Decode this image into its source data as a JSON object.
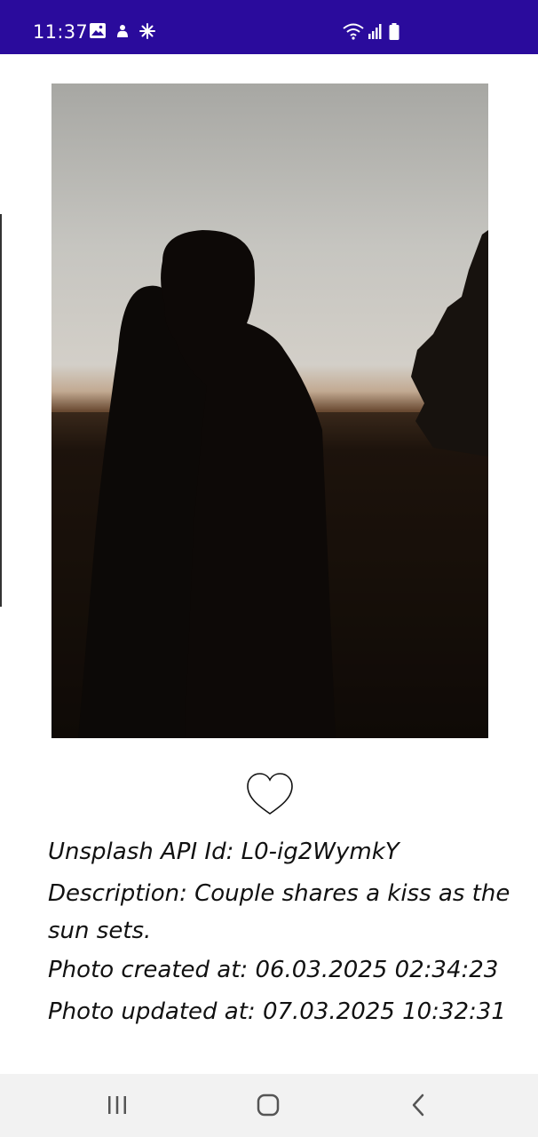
{
  "status_bar": {
    "time": "11:37",
    "left_icons": [
      "gallery-icon",
      "notification-icon",
      "sparkle-icon"
    ],
    "right_icons": [
      "wifi-icon",
      "signal-icon",
      "battery-icon"
    ],
    "color": "#2a0b9c"
  },
  "photo": {
    "alt": "Couple shares a kiss as the sun sets."
  },
  "like": {
    "icon": "heart-outline-icon",
    "liked": false
  },
  "details": {
    "api_id": "Unsplash API Id: L0-ig2WymkY",
    "description": "Description: Couple shares a kiss as the sun sets.",
    "created": "Photo created at: 06.03.2025 02:34:23",
    "updated": "Photo updated at: 07.03.2025 10:32:31"
  },
  "nav_bar": {
    "items": [
      "recent-apps-icon",
      "home-icon",
      "back-icon"
    ]
  }
}
